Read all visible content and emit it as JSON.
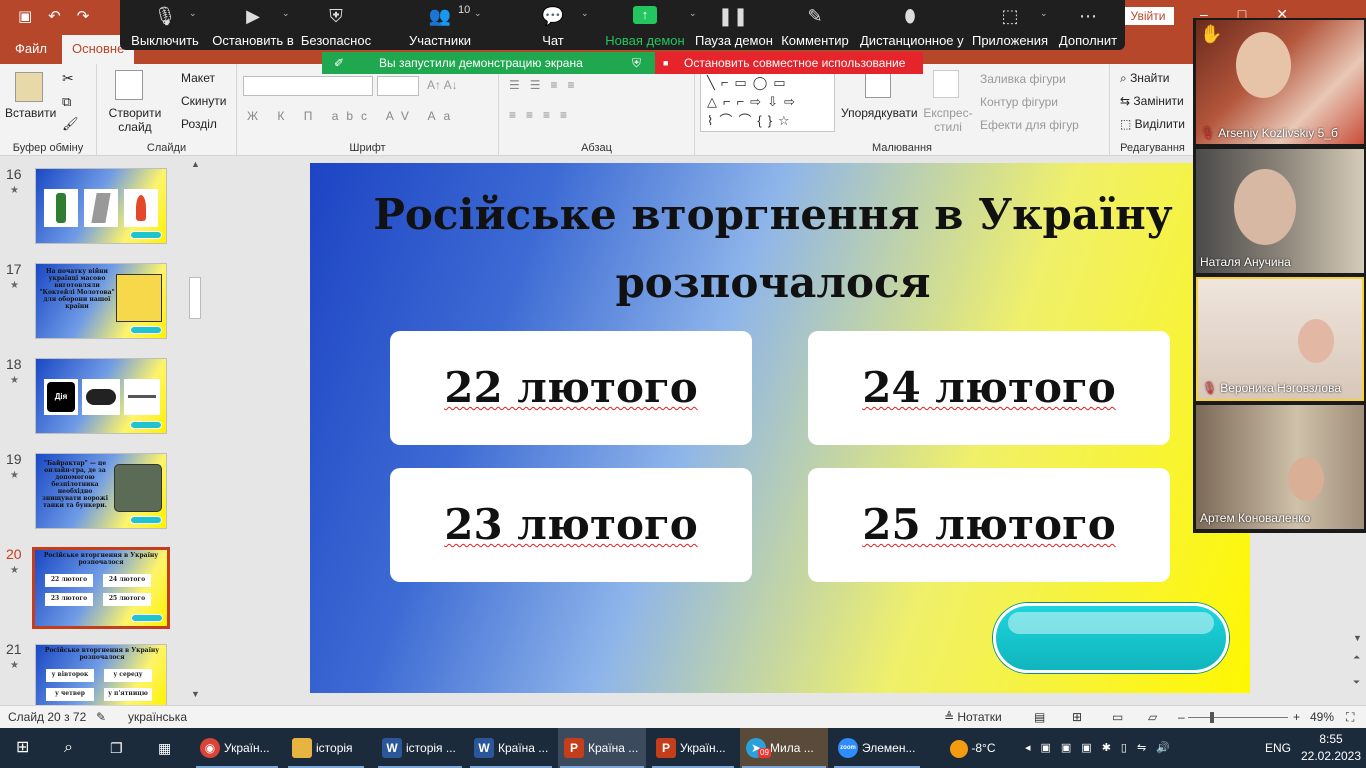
{
  "app": {
    "qat_icons": [
      "save-icon",
      "undo-icon",
      "redo-icon"
    ],
    "signin_label": "Увійти"
  },
  "tabs": [
    {
      "label": "Файл"
    },
    {
      "label": "Основне",
      "active": true
    }
  ],
  "ribbon": {
    "paste_label": "Вставити",
    "clipboard_group": "Буфер обміну",
    "new_slide_label": "Створити слайд",
    "layout_label": "Макет",
    "reset_label": "Скинути",
    "section_label": "Розділ",
    "slides_group": "Слайди",
    "font_group": "Шрифт",
    "font_format_buttons": "Ж К П abc AV Aa",
    "paragraph_group": "Абзац",
    "arrange_label": "Упорядкувати",
    "quick_styles_label": "Експрес-стилі",
    "shape_fill_label": "Заливка фігури",
    "shape_outline_label": "Контур фігури",
    "shape_effects_label": "Ефекти для фігур",
    "drawing_group": "Малювання",
    "find_label": "Знайти",
    "replace_label": "Замінити",
    "select_label": "Виділити",
    "editing_group": "Редагування"
  },
  "zoom_toolbar": {
    "items": [
      {
        "label": "Выключить",
        "icon": "microphone-icon"
      },
      {
        "label": "Остановить в",
        "icon": "video-camera-icon"
      },
      {
        "label": "Безопаснос",
        "icon": "shield-icon"
      },
      {
        "label": "Участники",
        "icon": "participants-icon",
        "count": "10"
      },
      {
        "label": "Чат",
        "icon": "chat-icon"
      },
      {
        "label": "Новая демон",
        "icon": "share-screen-icon"
      },
      {
        "label": "Пауза демон",
        "icon": "pause-icon"
      },
      {
        "label": "Комментир",
        "icon": "pencil-icon"
      },
      {
        "label": "Дистанционное у",
        "icon": "mouse-icon"
      },
      {
        "label": "Приложения",
        "icon": "apps-icon"
      },
      {
        "label": "Дополнит",
        "icon": "more-icon"
      }
    ],
    "share_banner": "Вы запустили демонстрацию экрана",
    "stop_share": "Остановить совместное использование"
  },
  "thumbnails": [
    {
      "num": "16"
    },
    {
      "num": "17",
      "text": "На початку війни українці масово виготовляли \"Коктейлі Молотова\" для оборони нашої країни"
    },
    {
      "num": "18",
      "badge": "Дія"
    },
    {
      "num": "19",
      "text": "\"Байрактар\" — це онлайн-гра, де за допомогою безпілотника необхідно знищувати ворожі танки та бункери."
    },
    {
      "num": "20",
      "active": true,
      "title": "Російське вторгнення в Україну розпочалося",
      "options": [
        "22 лютого",
        "24 лютого",
        "23 лютого",
        "25 лютого"
      ]
    },
    {
      "num": "21",
      "title": "Російське вторгнення в Україну розпочалося",
      "options": [
        "у вівторок",
        "у середу",
        "у четвер",
        "у п'ятницю"
      ]
    }
  ],
  "slide": {
    "title": "Російське вторгнення в Україну розпочалося",
    "answers": [
      "22 лютого",
      "24 лютого",
      "23 лютого",
      "25 лютого"
    ],
    "colors": {
      "gradient_start": "#1d44c4",
      "gradient_end": "#fff700",
      "button": "#1ec8cf"
    }
  },
  "participants": [
    {
      "name": "Arseniy Kozlivskiy 5_б",
      "muted": true,
      "raised_hand": true
    },
    {
      "name": "Наталя Анучина",
      "muted": false
    },
    {
      "name": "Вероника Нэговзлова",
      "muted": true,
      "active_speaker": true
    },
    {
      "name": "Артем Коноваленко",
      "muted": false
    }
  ],
  "statusbar": {
    "slide_info": "Слайд 20 з 72",
    "language": "українська",
    "notes_label": "Нотатки",
    "zoom": "49%"
  },
  "taskbar": {
    "apps": [
      {
        "label": "Україн...",
        "icon": "chrome-icon",
        "color": "#db4437"
      },
      {
        "label": "історія",
        "icon": "folder-icon",
        "color": "#e8b441"
      },
      {
        "label": "історія ...",
        "icon": "word-icon",
        "color": "#2b579a"
      },
      {
        "label": "Країна ...",
        "icon": "word-icon",
        "color": "#2b579a"
      },
      {
        "label": "Країна ...",
        "icon": "powerpoint-icon",
        "color": "#c43e1c",
        "active": true
      },
      {
        "label": "Україн...",
        "icon": "powerpoint-icon",
        "color": "#c43e1c"
      },
      {
        "label": "Мила ...",
        "icon": "telegram-icon",
        "color": "#2aa1da",
        "badge": "09"
      },
      {
        "label": "Элемен...",
        "icon": "zoom-icon",
        "color": "#2d8cff"
      }
    ],
    "weather": "-8°C",
    "language": "ENG",
    "time": "8:55",
    "date": "22.02.2023"
  }
}
